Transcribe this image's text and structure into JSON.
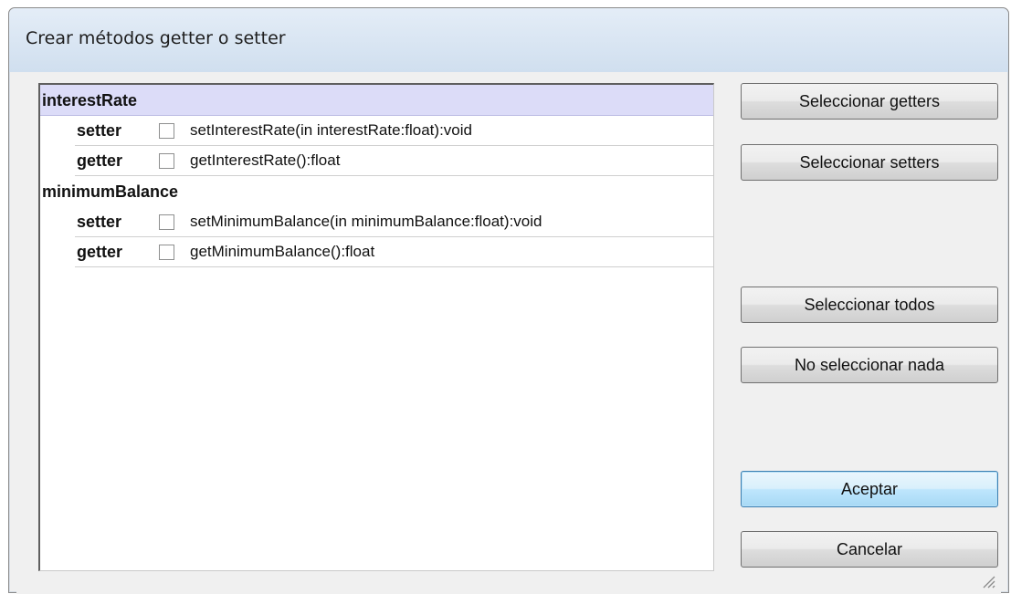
{
  "window": {
    "title": "Crear métodos getter o setter"
  },
  "attributes": [
    {
      "name": "interestRate",
      "selected": true,
      "methods": [
        {
          "kind": "setter",
          "checked": false,
          "signature": "setInterestRate(in interestRate:float):void"
        },
        {
          "kind": "getter",
          "checked": false,
          "signature": "getInterestRate():float"
        }
      ]
    },
    {
      "name": "minimumBalance",
      "selected": false,
      "methods": [
        {
          "kind": "setter",
          "checked": false,
          "signature": "setMinimumBalance(in minimumBalance:float):void"
        },
        {
          "kind": "getter",
          "checked": false,
          "signature": "getMinimumBalance():float"
        }
      ]
    }
  ],
  "buttons": {
    "select_getters": "Seleccionar getters",
    "select_setters": "Seleccionar setters",
    "select_all": "Seleccionar todos",
    "select_none": "No seleccionar nada",
    "ok": "Aceptar",
    "cancel": "Cancelar"
  },
  "colors": {
    "selected_row": "#dcdcf8",
    "title_bar": "#d6e3f1",
    "default_button": "#bee6fd"
  },
  "icons": {
    "resize_grip": "resize-grip-icon"
  }
}
